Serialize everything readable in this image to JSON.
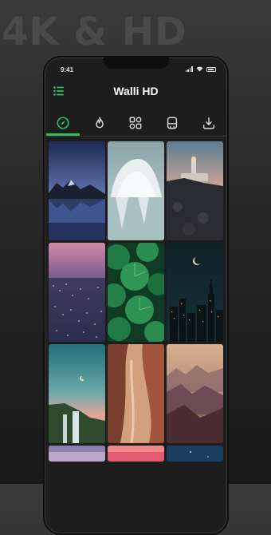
{
  "promo": {
    "headline": "4K & HD"
  },
  "status_bar": {
    "time": "9:41"
  },
  "app_bar": {
    "title": "Walli HD",
    "menu_icon": "menu-icon"
  },
  "tabs": [
    {
      "name": "explore",
      "icon": "compass-icon",
      "active": true
    },
    {
      "name": "popular",
      "icon": "flame-icon",
      "active": false
    },
    {
      "name": "categories",
      "icon": "categories-icon",
      "active": false
    },
    {
      "name": "collections",
      "icon": "bookmark-icon",
      "active": false
    },
    {
      "name": "downloads",
      "icon": "download-icon",
      "active": false
    }
  ],
  "wallpapers": [
    {
      "subject": "mountain-lake-night"
    },
    {
      "subject": "iceberg"
    },
    {
      "subject": "lighthouse-dusk"
    },
    {
      "subject": "city-night-pink"
    },
    {
      "subject": "green-leaves"
    },
    {
      "subject": "skyline-moon"
    },
    {
      "subject": "waterfall-teal-sky"
    },
    {
      "subject": "canyon"
    },
    {
      "subject": "misty-mountains"
    }
  ],
  "colors": {
    "accent": "#2ec15b",
    "background": "#1d1d1d",
    "title": "#ffffff"
  }
}
